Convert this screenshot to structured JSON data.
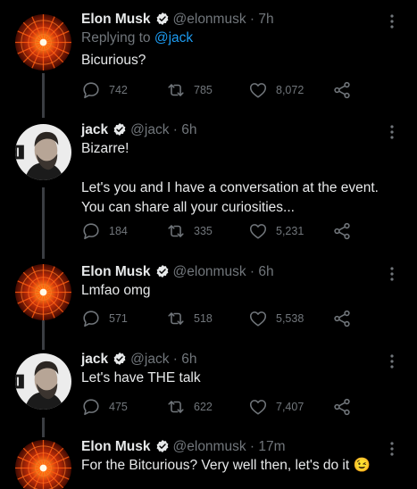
{
  "tweets": [
    {
      "name": "Elon Musk",
      "handle": "@elonmusk",
      "sep": "·",
      "time": "7h",
      "replying_prefix": "Replying to ",
      "replying_to": "@jack",
      "text": "Bicurious?",
      "replies": "742",
      "retweets": "785",
      "likes": "8,072"
    },
    {
      "name": "jack",
      "handle": "@jack",
      "sep": "·",
      "time": "6h",
      "text": "Bizarre!\n\nLet's you and I have a conversation at the event. You can share all your curiosities...",
      "replies": "184",
      "retweets": "335",
      "likes": "5,231"
    },
    {
      "name": "Elon Musk",
      "handle": "@elonmusk",
      "sep": "·",
      "time": "6h",
      "text": "Lmfao omg",
      "replies": "571",
      "retweets": "518",
      "likes": "5,538"
    },
    {
      "name": "jack",
      "handle": "@jack",
      "sep": "·",
      "time": "6h",
      "text": "Let's have THE talk",
      "replies": "475",
      "retweets": "622",
      "likes": "7,407"
    },
    {
      "name": "Elon Musk",
      "handle": "@elonmusk",
      "sep": "·",
      "time": "17m",
      "text": "For the Bitcurious? Very well then, let's do it 😉"
    }
  ],
  "colors": {
    "background": "#000000",
    "primary_text": "#e7e9ea",
    "secondary_text": "#71767b",
    "link": "#1d9bf0",
    "verified": "#1d9bf0"
  }
}
